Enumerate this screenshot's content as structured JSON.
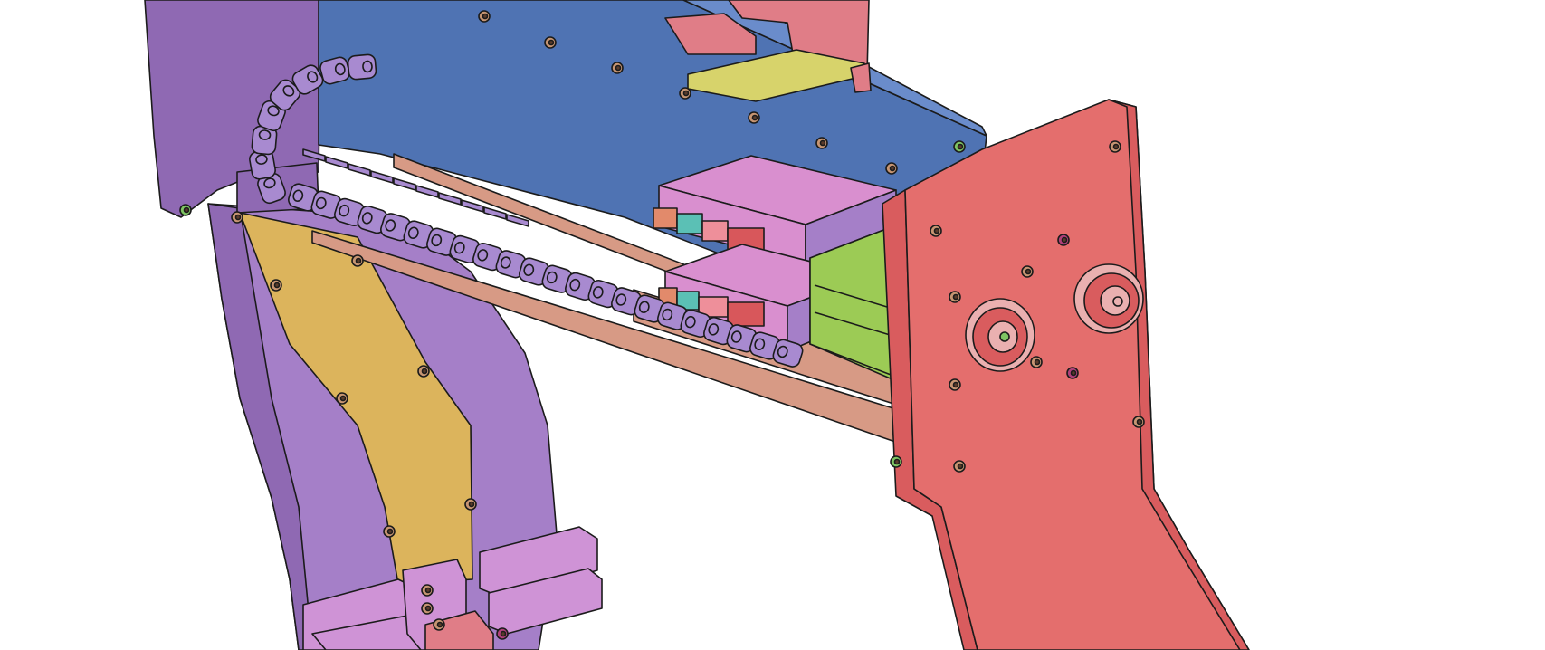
{
  "scene": {
    "background": "#ffffff",
    "outline": "#1b1b1b",
    "parts": {
      "left_side_plate": "#a57fc8",
      "left_side_plate_shade": "#8f69b3",
      "yellow_strip": "#dcb45c",
      "blue_beam": "#4f73b3",
      "blue_beam_top": "#6a8ccb",
      "brown_rail": "#d79a85",
      "cable_chain": "#a88ad0",
      "driver_box": "#d98fcf",
      "green_motor": "#9ccb55",
      "right_side_plate": "#d95c5e",
      "right_side_plate_light": "#e46e6d",
      "pulley": "#eab0b0",
      "linear_blocks": "#cf93d6",
      "top_bracket_pink": "#e07d87",
      "top_plate_yellow": "#d7d36b",
      "bolt": "#c79572",
      "bolt_green": "#7fc463",
      "bolt_magenta": "#b0407a",
      "terminal_orange": "#e28a6b",
      "terminal_teal": "#5bc0b5",
      "terminal_red": "#d8575b",
      "terminal_pink": "#ee8f9a"
    }
  }
}
